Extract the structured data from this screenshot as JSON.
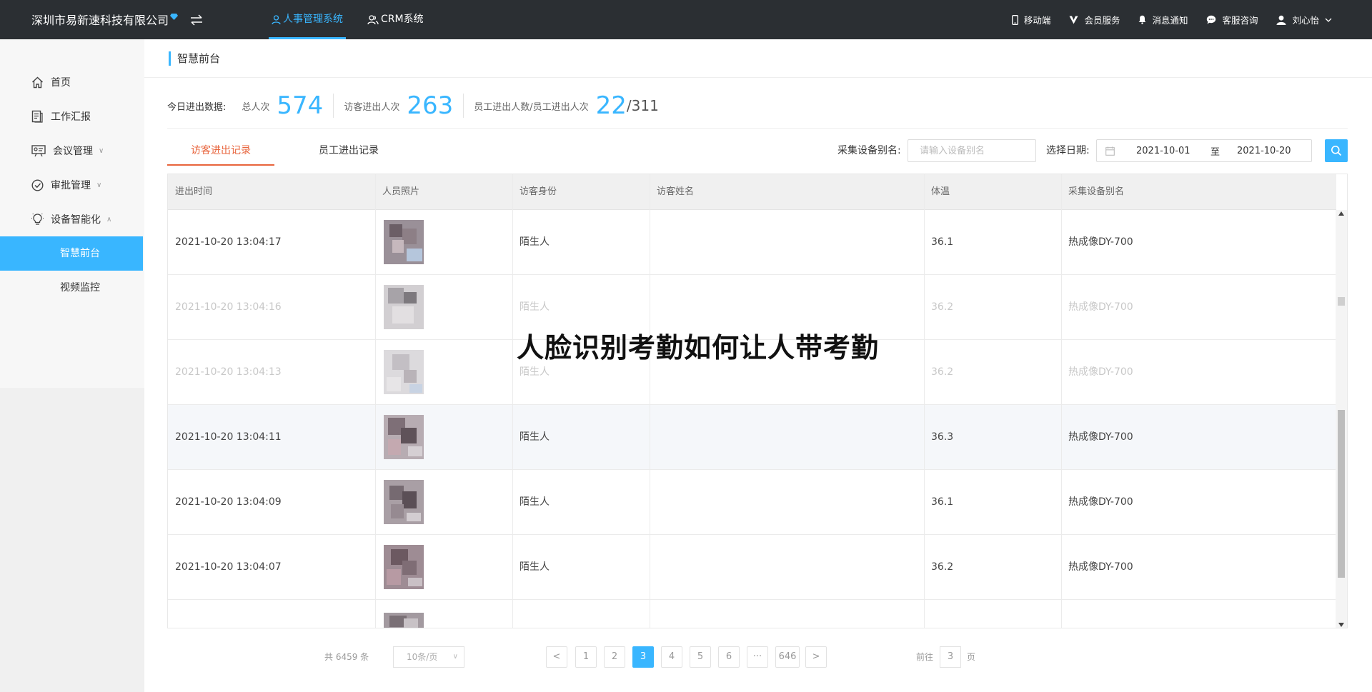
{
  "colors": {
    "accent": "#39b6ff",
    "tab_active": "#e8643c",
    "topbar": "#2b2f33"
  },
  "topbar": {
    "company": "深圳市易新速科技有限公司",
    "nav": [
      {
        "label": "人事管理系统",
        "icon": "person-icon",
        "active": true
      },
      {
        "label": "CRM系统",
        "icon": "people-icon",
        "active": false
      }
    ],
    "tools": {
      "mobile": "移动端",
      "vip": "会员服务",
      "notify": "消息通知",
      "support": "客服咨询",
      "user": "刘心怡"
    }
  },
  "sidebar": {
    "items": [
      {
        "label": "首页",
        "icon": "home-icon"
      },
      {
        "label": "工作汇报",
        "icon": "report-icon"
      },
      {
        "label": "会议管理",
        "icon": "meeting-icon",
        "caret": "∨"
      },
      {
        "label": "审批管理",
        "icon": "approval-icon",
        "caret": "∨"
      },
      {
        "label": "设备智能化",
        "icon": "bulb-icon",
        "caret": "∧"
      }
    ],
    "subitems": [
      {
        "label": "智慧前台",
        "active": true
      },
      {
        "label": "视频监控",
        "active": false
      }
    ]
  },
  "main": {
    "breadcrumb": "智慧前台",
    "stats": {
      "title": "今日进出数据:",
      "total_label": "总人次",
      "total_value": "574",
      "visitor_label": "访客进出人次",
      "visitor_value": "263",
      "staff_label": "员工进出人数/员工进出人次",
      "staff_value": "22",
      "staff_total": "/311"
    },
    "tabs": [
      "访客进出记录",
      "员工进出记录"
    ],
    "filter": {
      "device_label": "采集设备别名:",
      "device_placeholder": "请输入设备别名",
      "date_label": "选择日期:",
      "date_start": "2021-10-01",
      "date_sep": "至",
      "date_end": "2021-10-20"
    },
    "table": {
      "headers": [
        "进出时间",
        "人员照片",
        "访客身份",
        "访客姓名",
        "体温",
        "采集设备别名"
      ],
      "rows": [
        {
          "time": "2021-10-20 13:04:17",
          "identity": "陌生人",
          "name": "",
          "temp": "36.1",
          "device": "热成像DY-700"
        },
        {
          "time": "2021-10-20 13:04:16",
          "identity": "陌生人",
          "name": "",
          "temp": "36.2",
          "device": "热成像DY-700"
        },
        {
          "time": "2021-10-20 13:04:13",
          "identity": "陌生人",
          "name": "",
          "temp": "36.2",
          "device": "热成像DY-700"
        },
        {
          "time": "2021-10-20 13:04:11",
          "identity": "陌生人",
          "name": "",
          "temp": "36.3",
          "device": "热成像DY-700"
        },
        {
          "time": "2021-10-20 13:04:09",
          "identity": "陌生人",
          "name": "",
          "temp": "36.1",
          "device": "热成像DY-700"
        },
        {
          "time": "2021-10-20 13:04:07",
          "identity": "陌生人",
          "name": "",
          "temp": "36.2",
          "device": "热成像DY-700"
        },
        {
          "time": "",
          "identity": "",
          "name": "",
          "temp": "",
          "device": ""
        }
      ]
    },
    "overlay_text": "人脸识别考勤如何让人带考勤"
  },
  "pagination": {
    "total": "共 6459 条",
    "page_size": "10条/页",
    "prev": "<",
    "pages": [
      "1",
      "2",
      "3",
      "4",
      "5",
      "6",
      "···",
      "646"
    ],
    "current": "3",
    "next": ">",
    "goto_label": "前往",
    "goto_value": "3",
    "goto_unit": "页"
  }
}
